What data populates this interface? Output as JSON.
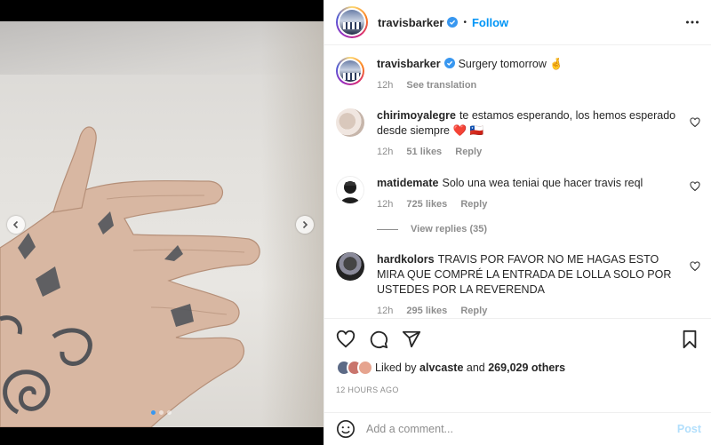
{
  "post": {
    "author": "travisbarker",
    "follow_label": "Follow",
    "separator": "•",
    "caption": {
      "username": "travisbarker",
      "text": "Surgery tomorrow 🤞",
      "time": "12h",
      "see_translation": "See translation"
    },
    "comments": [
      {
        "username": "chirimoyalegre",
        "text": "te estamos esperando, los hemos esperado desde siempre ❤️ 🇨🇱",
        "time": "12h",
        "likes": "51 likes",
        "reply": "Reply"
      },
      {
        "username": "matidemate",
        "text": "Solo una wea teniai que hacer travis reql",
        "time": "12h",
        "likes": "725 likes",
        "reply": "Reply"
      },
      {
        "username": "hardkolors",
        "text": "TRAVIS POR FAVOR NO ME HAGAS ESTO MIRA QUE COMPRÉ LA ENTRADA DE LOLLA SOLO POR USTEDES POR LA REVERENDA",
        "time": "12h",
        "likes": "295 likes",
        "reply": "Reply"
      }
    ],
    "view_replies": "View replies (35)",
    "liked_by_prefix": "Liked by",
    "liked_by_user": "alvcaste",
    "liked_by_and": "and",
    "liked_by_others": "269,029 others",
    "timestamp": "12 HOURS AGO",
    "add_comment_placeholder": "Add a comment...",
    "post_button": "Post",
    "carousel": {
      "slides": 3,
      "active": 1
    }
  },
  "colors": {
    "accent": "#0095f6",
    "post_disabled": "#b2dffc",
    "muted": "#8e8e8e",
    "heart": "#ed4956"
  }
}
